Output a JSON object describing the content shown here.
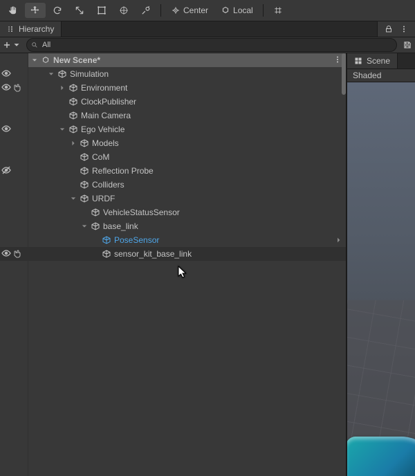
{
  "toolbar": {
    "center": "Center",
    "local": "Local"
  },
  "hierarchy": {
    "tab_label": "Hierarchy",
    "add_symbol": "+",
    "search_value": "All",
    "scene_name": "New Scene*",
    "nodes": [
      {
        "id": "simulation",
        "label": "Simulation",
        "depth": 1,
        "expanded": true,
        "hasChildren": true,
        "selected": false,
        "visOn": true,
        "pick": false,
        "scene": false
      },
      {
        "id": "environment",
        "label": "Environment",
        "depth": 2,
        "expanded": false,
        "hasChildren": true,
        "selected": false,
        "visOn": true,
        "pick": true,
        "scene": false
      },
      {
        "id": "clock-publisher",
        "label": "ClockPublisher",
        "depth": 2,
        "expanded": false,
        "hasChildren": false,
        "selected": false,
        "visOn": false,
        "pick": false,
        "scene": false
      },
      {
        "id": "main-camera",
        "label": "Main Camera",
        "depth": 2,
        "expanded": false,
        "hasChildren": false,
        "selected": false,
        "visOn": false,
        "pick": false,
        "scene": false
      },
      {
        "id": "ego-vehicle",
        "label": "Ego Vehicle",
        "depth": 2,
        "expanded": true,
        "hasChildren": true,
        "selected": false,
        "visOn": true,
        "pick": false,
        "scene": false
      },
      {
        "id": "models",
        "label": "Models",
        "depth": 3,
        "expanded": false,
        "hasChildren": true,
        "selected": false,
        "visOn": false,
        "pick": false,
        "scene": false
      },
      {
        "id": "com",
        "label": "CoM",
        "depth": 3,
        "expanded": false,
        "hasChildren": false,
        "selected": false,
        "visOn": false,
        "pick": false,
        "scene": false
      },
      {
        "id": "reflection-probe",
        "label": "Reflection Probe",
        "depth": 3,
        "expanded": false,
        "hasChildren": false,
        "selected": false,
        "visOn": true,
        "crossed": true,
        "pick": false,
        "scene": false
      },
      {
        "id": "colliders",
        "label": "Colliders",
        "depth": 3,
        "expanded": false,
        "hasChildren": false,
        "selected": false,
        "visOn": false,
        "pick": false,
        "scene": false
      },
      {
        "id": "urdf",
        "label": "URDF",
        "depth": 3,
        "expanded": true,
        "hasChildren": true,
        "selected": false,
        "visOn": false,
        "pick": false,
        "scene": false
      },
      {
        "id": "vehicle-status-sensor",
        "label": "VehicleStatusSensor",
        "depth": 4,
        "expanded": false,
        "hasChildren": false,
        "selected": false,
        "visOn": false,
        "pick": false,
        "scene": false
      },
      {
        "id": "base-link",
        "label": "base_link",
        "depth": 4,
        "expanded": true,
        "hasChildren": true,
        "selected": false,
        "visOn": false,
        "pick": false,
        "scene": false
      },
      {
        "id": "pose-sensor",
        "label": "PoseSensor",
        "depth": 5,
        "expanded": false,
        "hasChildren": false,
        "selected": true,
        "visOn": false,
        "pick": false,
        "scene": false,
        "chevron": true
      },
      {
        "id": "sensor-kit-base-link",
        "label": "sensor_kit_base_link",
        "depth": 5,
        "expanded": false,
        "hasChildren": false,
        "selected": false,
        "visOn": true,
        "pick": true,
        "scene": false,
        "highlight": true
      }
    ]
  },
  "scene": {
    "tab_label": "Scene",
    "shading_mode": "Shaded"
  }
}
